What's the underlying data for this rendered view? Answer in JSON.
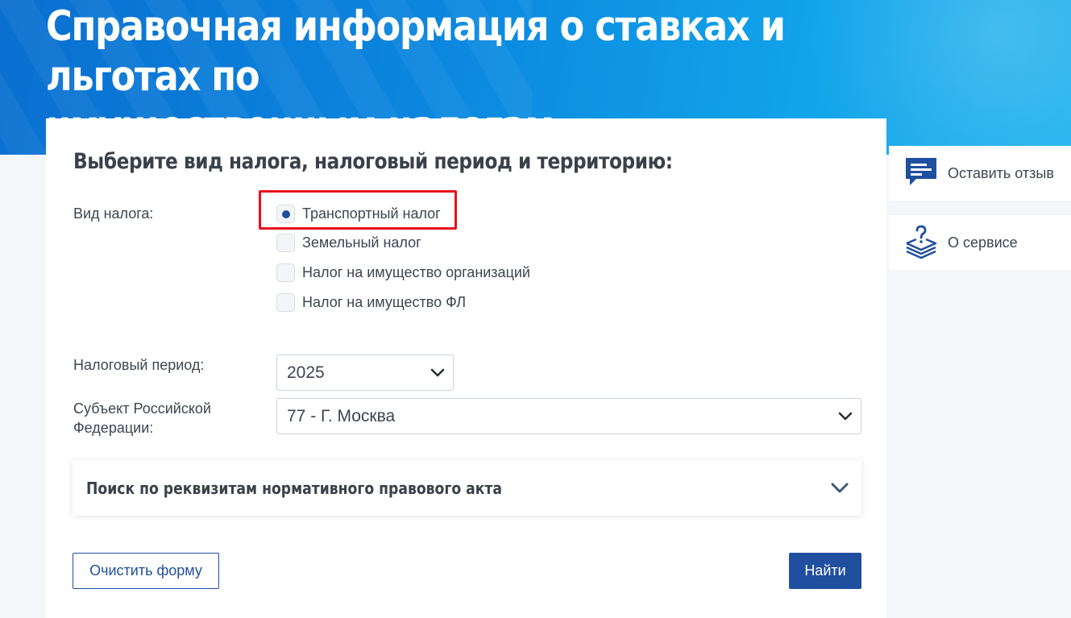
{
  "header": {
    "title_line1": "Справочная информация о ставках и льготах по",
    "title_line2": "имущественным налогам"
  },
  "form": {
    "heading": "Выберите вид налога, налоговый период и территорию:",
    "tax_type_label": "Вид налога:",
    "tax_types": [
      {
        "label": "Транспортный налог",
        "checked": true
      },
      {
        "label": "Земельный налог",
        "checked": false
      },
      {
        "label": "Налог на имущество организаций",
        "checked": false
      },
      {
        "label": "Налог на имущество ФЛ",
        "checked": false
      }
    ],
    "period_label": "Налоговый период:",
    "period_value": "2025",
    "region_label_line1": "Субъект Российской",
    "region_label_line2": "Федерации:",
    "region_value": "77 - Г. Москва",
    "accordion_title": "Поиск по реквизитам нормативного правового акта",
    "clear_button": "Очистить форму",
    "find_button": "Найти"
  },
  "sidebar": {
    "feedback_label": "Оставить отзыв",
    "about_label": "О сервисе"
  },
  "colors": {
    "accent": "#1f4f9e",
    "highlight": "#e8101b",
    "banner": "#0b86de"
  }
}
